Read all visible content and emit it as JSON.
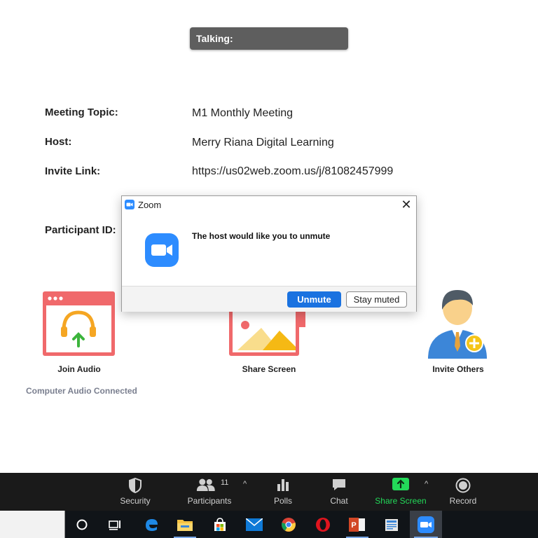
{
  "talking": {
    "label": "Talking:"
  },
  "meeting_info": {
    "topic_label": "Meeting Topic:",
    "topic_value": "M1 Monthly Meeting",
    "host_label": "Host:",
    "host_value": "Merry Riana Digital Learning",
    "invite_label": "Invite Link:",
    "invite_value": "https://us02web.zoom.us/j/81082457999",
    "participant_label": "Participant ID:"
  },
  "dialog": {
    "title": "Zoom",
    "close_glyph": "✕",
    "message": "The host would like you to unmute",
    "unmute_label": "Unmute",
    "stay_label": "Stay muted"
  },
  "actions": {
    "join_audio": "Join Audio",
    "audio_status": "Computer Audio Connected",
    "share_screen": "Share Screen",
    "invite_others": "Invite Others"
  },
  "toolbar": {
    "security": "Security",
    "participants": "Participants",
    "participant_count": "11",
    "polls": "Polls",
    "chat": "Chat",
    "share_screen": "Share Screen",
    "record": "Record",
    "caret": "^"
  },
  "colors": {
    "accent": "#1a72e0",
    "share_green": "#23d959",
    "tile_red": "#f0696b",
    "toolbar_bg": "#1a1a1a"
  },
  "taskbar": {
    "icons": [
      "cortana-icon",
      "task-view-icon",
      "edge-icon",
      "file-explorer-icon",
      "store-icon",
      "mail-icon",
      "chrome-icon",
      "opera-icon",
      "powerpoint-icon",
      "publisher-icon",
      "zoom-icon"
    ]
  }
}
